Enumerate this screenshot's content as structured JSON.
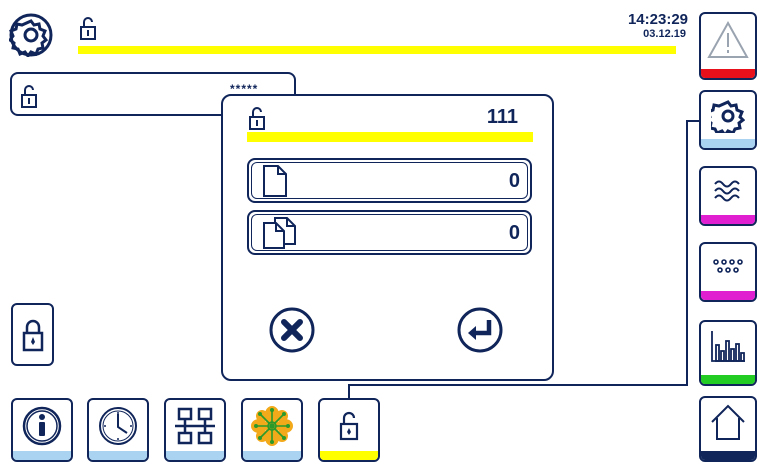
{
  "header": {
    "time": "14:23:29",
    "date": "03.12.19",
    "progress_color": "#ffff00"
  },
  "password_field": {
    "value": "*****"
  },
  "dialog": {
    "title_value": "111",
    "fields": [
      {
        "icon": "single-document-icon",
        "value": "0"
      },
      {
        "icon": "multiple-documents-icon",
        "value": "0"
      }
    ],
    "cancel_icon": "cancel-x-icon",
    "confirm_icon": "enter-return-icon"
  },
  "sidebar": [
    {
      "icon": "warning-triangle-icon",
      "status_color": "#e8101a"
    },
    {
      "icon": "gear-icon",
      "status_color": "#a9d3f0"
    },
    {
      "icon": "waves-icon",
      "status_color": "#e020d0"
    },
    {
      "icon": "dots-grid-icon",
      "status_color": "#e020d0"
    },
    {
      "icon": "bar-chart-icon",
      "status_color": "#22cc22"
    },
    {
      "icon": "home-icon",
      "status_color": "#10255a"
    }
  ],
  "bottom_bar": [
    {
      "icon": "info-icon",
      "status_color": "#a9d3f0"
    },
    {
      "icon": "clock-icon",
      "status_color": "#a9d3f0"
    },
    {
      "icon": "network-icon",
      "status_color": "#a9d3f0"
    },
    {
      "icon": "virus-icon",
      "status_color": "#a9d3f0"
    },
    {
      "icon": "lock-icon",
      "status_color": "#ffff00"
    }
  ]
}
